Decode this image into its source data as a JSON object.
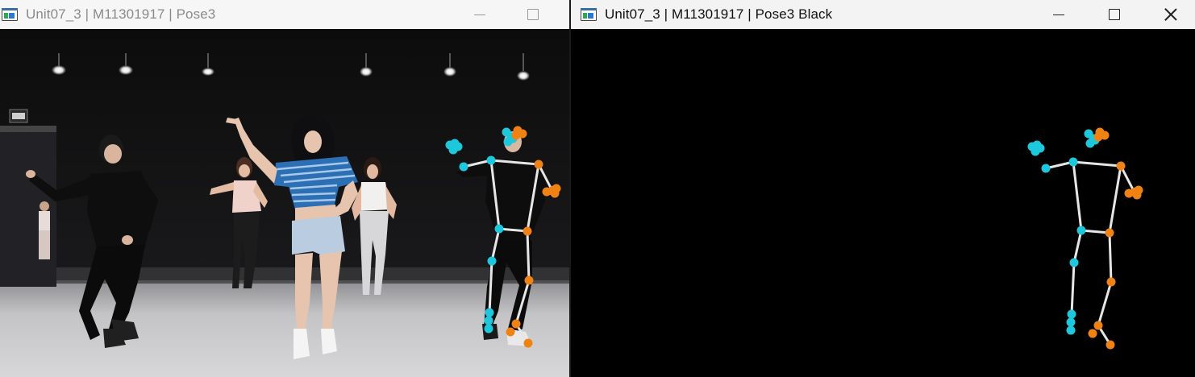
{
  "left_window": {
    "title": "Unit07_3 | M11301917 | Pose3",
    "icon": "opencv-window-icon",
    "controls": [
      "minimize-icon",
      "maximize-icon"
    ]
  },
  "right_window": {
    "title": "Unit07_3 | M11301917 | Pose3 Black",
    "icon": "opencv-window-icon",
    "controls": [
      "minimize-icon",
      "maximize-icon",
      "close-icon"
    ]
  },
  "colors": {
    "left_side_keypoint": "#1ec8dc",
    "right_side_keypoint": "#f08214",
    "skeleton_line": "#e6e6e6",
    "black_canvas": "#000000"
  }
}
